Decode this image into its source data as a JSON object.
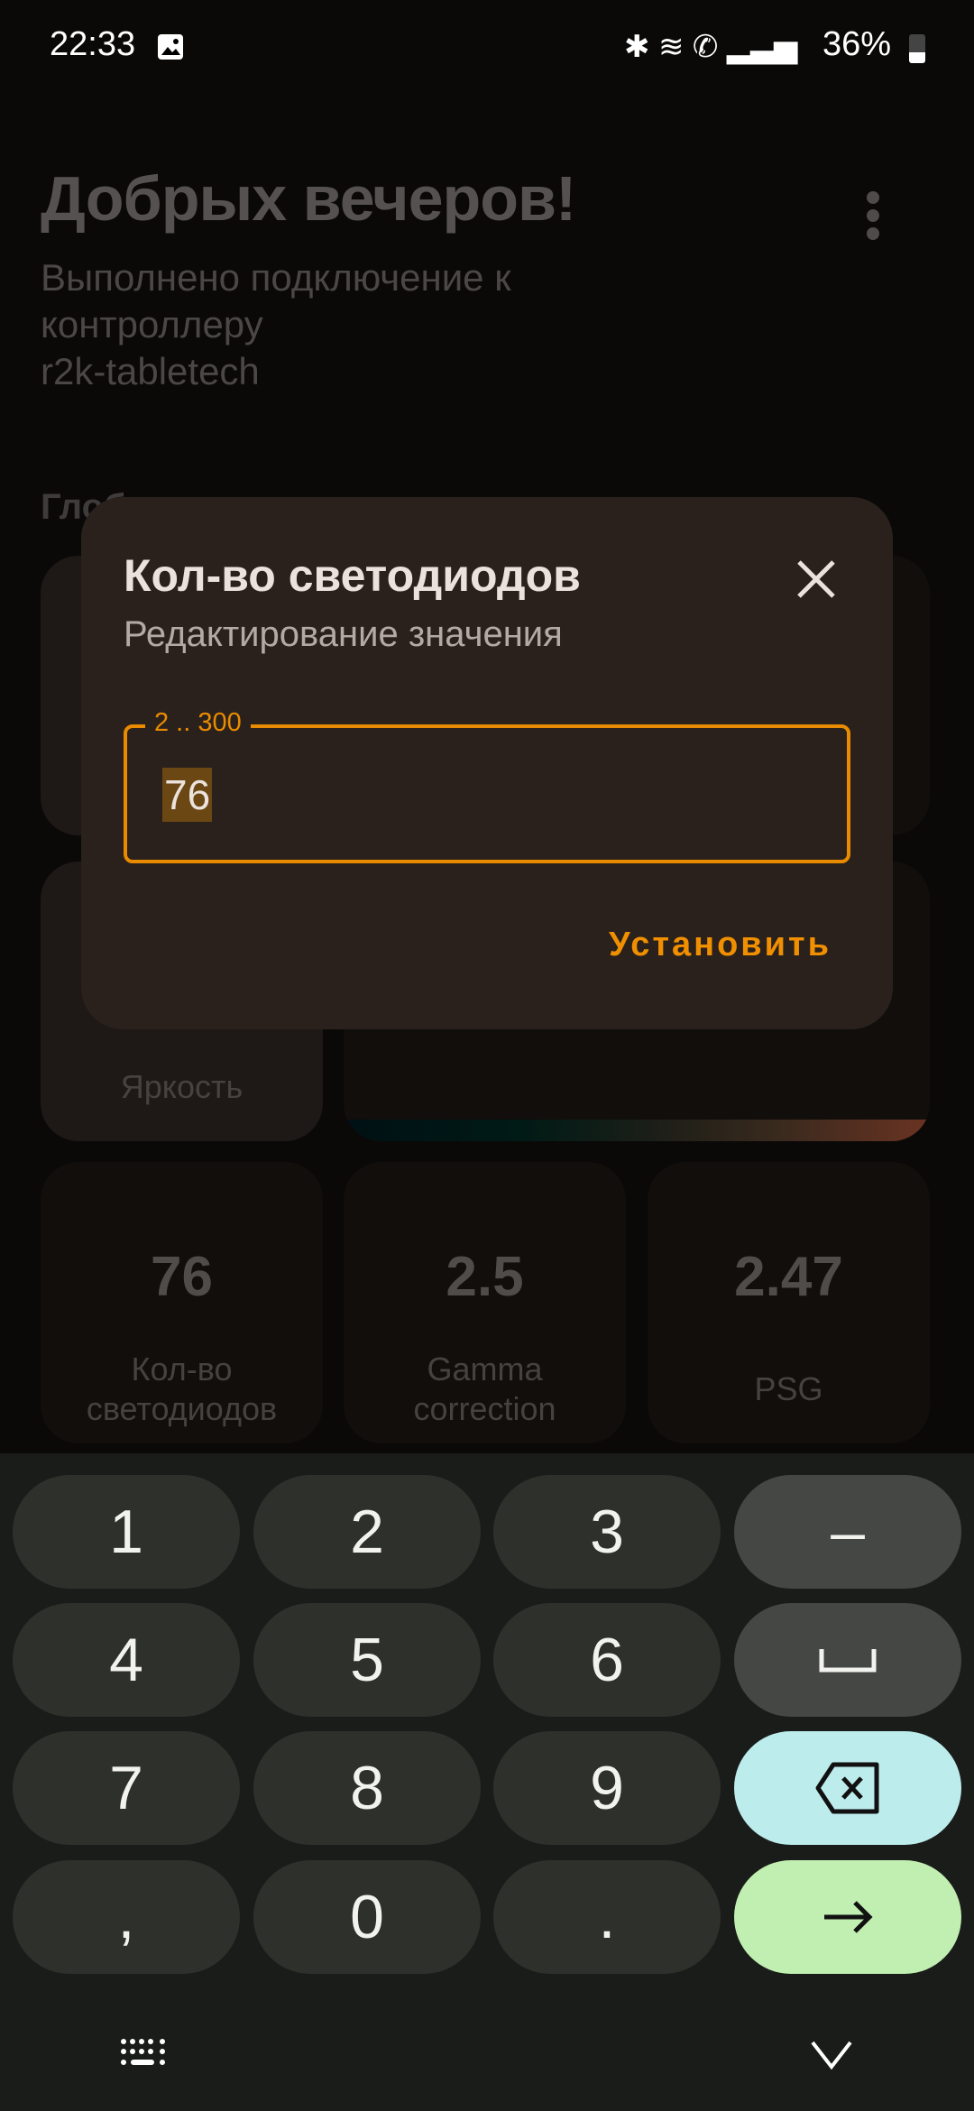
{
  "status_bar": {
    "time": "22:33",
    "battery": "36%"
  },
  "header": {
    "title": "Добрых вечеров!",
    "subtitle_lines": [
      "Выполнено подключение к",
      "контроллеру",
      "r2k-tabletech"
    ],
    "section_label": "Глоб"
  },
  "cards": [
    {
      "label": "Яркость"
    },
    {
      "value": "76",
      "label_lines": [
        "Кол-во",
        "светодиодов"
      ]
    },
    {
      "value": "2.5",
      "label_lines": [
        "Gamma",
        "correction"
      ]
    },
    {
      "value": "2.47",
      "label_lines": [
        "PSG"
      ]
    }
  ],
  "dialog": {
    "title": "Кол-во светодиодов",
    "subtitle": "Редактирование значения",
    "field_label": "2 .. 300",
    "field_value": "76",
    "set_label": "Установить",
    "accent": "#e88b00"
  },
  "keyboard": {
    "keys": [
      [
        "1",
        "2",
        "3",
        "–"
      ],
      [
        "4",
        "5",
        "6",
        "space"
      ],
      [
        "7",
        "8",
        "9",
        "backspace"
      ],
      [
        ",",
        "0",
        ".",
        "enter"
      ]
    ]
  }
}
